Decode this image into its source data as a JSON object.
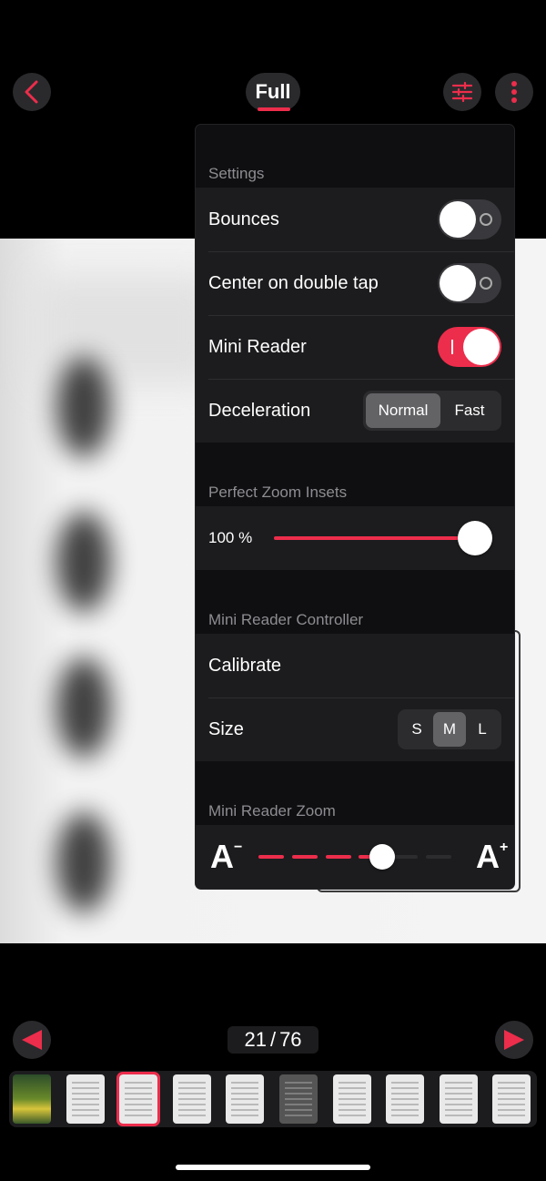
{
  "top_bar": {
    "mode_label": "Full",
    "back_icon": "chevron-left-icon",
    "settings_icon": "sliders-icon",
    "more_icon": "vertical-ellipsis-icon"
  },
  "accent_color": "#ec2d4b",
  "settings": {
    "title": "Settings",
    "rows": [
      {
        "label": "Bounces",
        "type": "toggle",
        "value": false
      },
      {
        "label": "Center on double tap",
        "type": "toggle",
        "value": false
      },
      {
        "label": "Mini Reader",
        "type": "toggle",
        "value": true
      },
      {
        "label": "Deceleration",
        "type": "segmented",
        "options": [
          "Normal",
          "Fast"
        ],
        "selected": "Normal"
      }
    ]
  },
  "perfect_zoom": {
    "title": "Perfect Zoom Insets",
    "value_label": "100 %",
    "value_fraction": 1.0
  },
  "mini_reader_controller": {
    "title": "Mini Reader Controller",
    "calibrate_label": "Calibrate",
    "size_label": "Size",
    "size_options": [
      "S",
      "M",
      "L"
    ],
    "size_selected": "M"
  },
  "mini_reader_zoom": {
    "title": "Mini Reader Zoom",
    "decrease_label": "A",
    "decrease_mark": "−",
    "increase_label": "A",
    "increase_mark": "+",
    "level_fraction": 0.64
  },
  "pager": {
    "current": "21",
    "separator": "/",
    "total": "76",
    "prev_icon": "triangle-left-icon",
    "next_icon": "triangle-right-icon"
  },
  "thumbnails": [
    {
      "kind": "cover"
    },
    {
      "kind": "text"
    },
    {
      "kind": "text",
      "selected": true
    },
    {
      "kind": "text"
    },
    {
      "kind": "text"
    },
    {
      "kind": "dark"
    },
    {
      "kind": "text"
    },
    {
      "kind": "text"
    },
    {
      "kind": "text"
    },
    {
      "kind": "text"
    }
  ]
}
